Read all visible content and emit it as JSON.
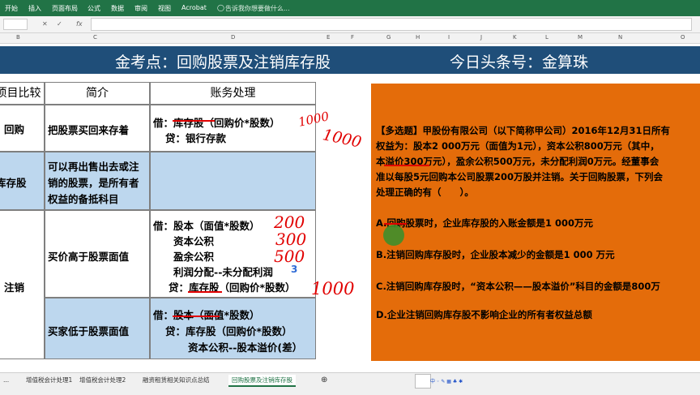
{
  "ribbon": {
    "tabs": [
      "开始",
      "插入",
      "页面布局",
      "公式",
      "数据",
      "审阅",
      "视图",
      "Acrobat"
    ],
    "tell_me": "告诉我你想要做什么..."
  },
  "formula_bar": {
    "fx": "fx",
    "cancel": "✕",
    "enter": "✓"
  },
  "columns": [
    "B",
    "C",
    "D",
    "E",
    "F",
    "G",
    "H",
    "I",
    "J",
    "K",
    "L",
    "M",
    "N",
    "O"
  ],
  "banner": {
    "left_title": "金考点：回购股票及注销库存股",
    "right_title": "今日头条号：金算珠"
  },
  "table": {
    "headers": [
      "项目比较",
      "简介",
      "账务处理"
    ],
    "rows": [
      {
        "item": "回购",
        "intro": "把股票买回来存着",
        "entry_lines": [
          "借：库存股（回购价*股数）",
          "贷：银行存款"
        ]
      },
      {
        "item": "库存股",
        "intro_lines": [
          "可以再出售出去或注",
          "销的股票，是所有者",
          "权益的备抵科目"
        ],
        "entry_lines": []
      },
      {
        "item": "注销",
        "intro": "买价高于股票面值",
        "entry_lines": [
          "借：股本（面值*股数）",
          "资本公积",
          "盈余公积",
          "利润分配--未分配利润",
          "贷：库存股（回购价*股数）"
        ]
      },
      {
        "item": "",
        "intro": "买家低于股票面值",
        "entry_lines": [
          "借：股本（面值*股数）",
          "贷：库存股（回购价*股数）",
          "资本公积--股本溢价(差）"
        ]
      }
    ]
  },
  "handwriting": {
    "n1": "1000",
    "n2": "1000",
    "n3": "200",
    "n4": "300",
    "n5": "500",
    "n6": "3",
    "n7": "1000"
  },
  "question": {
    "lines": [
      "【多选题】甲股份有限公司（以下简称甲公司）2016年12月31日所有",
      "权益为：股本2 000万元（面值为1元），资本公积800万元（其中，",
      "本溢价300万元），盈余公积500万元，未分配利润0万元。经董事会",
      "准以每股5元回购本公司股票200万股并注销。关于回购股票，下列会",
      "处理正确的有（　　）。"
    ],
    "options": [
      "A.回购股票时，企业库存股的入账金额是1 000万元",
      "B.注销回购库存股时，企业股本减少的金额是1 000 万元",
      "C.注销回购库存股时，“资本公积——股本溢价”科目的金额是800万",
      "D.企业注销回购库存股不影响企业的所有者权益总额"
    ]
  },
  "sheet_tabs": [
    "...",
    "增值税会计处理1",
    "增值税会计处理2",
    "融资租赁相关知识点总结",
    "回购股票及注销库存股"
  ],
  "active_tab": "回购股票及注销库存股",
  "colors": {
    "ribbon": "#217346",
    "banner": "#1f4e79",
    "question_bg": "#e46c0a",
    "table_blue": "#bdd7ee",
    "ink": "#e10000"
  }
}
